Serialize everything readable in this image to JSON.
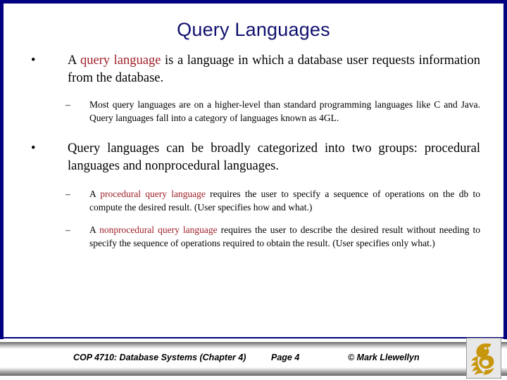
{
  "slide": {
    "title": "Query Languages",
    "border_color": "#000080",
    "title_color": "#101070",
    "highlight_color": "#A02028",
    "background": "#ffffff"
  },
  "bullets": [
    {
      "level": 1,
      "marker": "•",
      "parts": [
        {
          "text": "A ",
          "style": "normal"
        },
        {
          "text": "query language",
          "style": "highlight"
        },
        {
          "text": " is a language in which a database user requests information from the database.",
          "style": "normal"
        }
      ],
      "plain": "A query language is a language in which a database user requests information from the database."
    },
    {
      "level": 2,
      "marker": "–",
      "parts": [
        {
          "text": "Most query languages are on a higher-level than standard programming languages like C and Java.  Query languages fall into a category of languages known as 4GL.",
          "style": "normal"
        }
      ],
      "plain": "Most query languages are on a higher-level than standard programming languages like C and Java.  Query languages fall into a category of languages known as 4GL."
    },
    {
      "level": 1,
      "marker": "•",
      "parts": [
        {
          "text": "Query languages can be broadly categorized into two groups:   procedural languages and nonprocedural languages.",
          "style": "normal"
        }
      ],
      "plain": "Query languages can be broadly categorized into two groups:   procedural languages and nonprocedural languages."
    },
    {
      "level": 2,
      "marker": "–",
      "parts": [
        {
          "text": "A ",
          "style": "normal"
        },
        {
          "text": "procedural query language",
          "style": "highlight"
        },
        {
          "text": " requires the user to specify a sequence of operations on the db to compute the desired result.  (User specifies how and what.)",
          "style": "normal"
        }
      ],
      "plain": "A procedural query language requires the user to specify a sequence of operations on the db to compute the desired result.  (User specifies how and what.)"
    },
    {
      "level": 2,
      "marker": "–",
      "parts": [
        {
          "text": "A ",
          "style": "normal"
        },
        {
          "text": "nonprocedural query language",
          "style": "highlight"
        },
        {
          "text": " requires the user to describe the desired result without needing to specify the  sequence of operations required to obtain the result. (User specifies only what.)",
          "style": "normal"
        }
      ],
      "plain": "A nonprocedural query language requires the user to describe the desired result without needing to specify the  sequence of operations required to obtain the result. (User specifies only what.)"
    }
  ],
  "bullet_text": {
    "b1_pre": "A ",
    "b1_red": "query language",
    "b1_post": " is a language in which a database user requests information from the database.",
    "b2": "Most query languages are on a higher-level than standard programming languages like C and Java.  Query languages fall into a category of languages known as 4GL.",
    "b3": "Query languages can be broadly categorized into two groups:   procedural languages and nonprocedural languages.",
    "b4_pre": "A ",
    "b4_red": "procedural query language",
    "b4_post": " requires the user to specify a sequence of operations on the db to compute the desired result.  (User specifies how and what.)",
    "b5_pre": "A ",
    "b5_red": "nonprocedural query language",
    "b5_post": " requires the user to describe the desired result without needing to specify the  sequence of operations required to obtain the result. (User specifies only what.)"
  },
  "markers": {
    "level1": "•",
    "level2": "–"
  },
  "footer": {
    "course": "COP 4710: Database Systems  (Chapter 4)",
    "page": "Page 4",
    "credit": "© Mark Llewellyn",
    "logo_name": "ucf-pegasus-logo",
    "logo_color": "#C8960C"
  }
}
